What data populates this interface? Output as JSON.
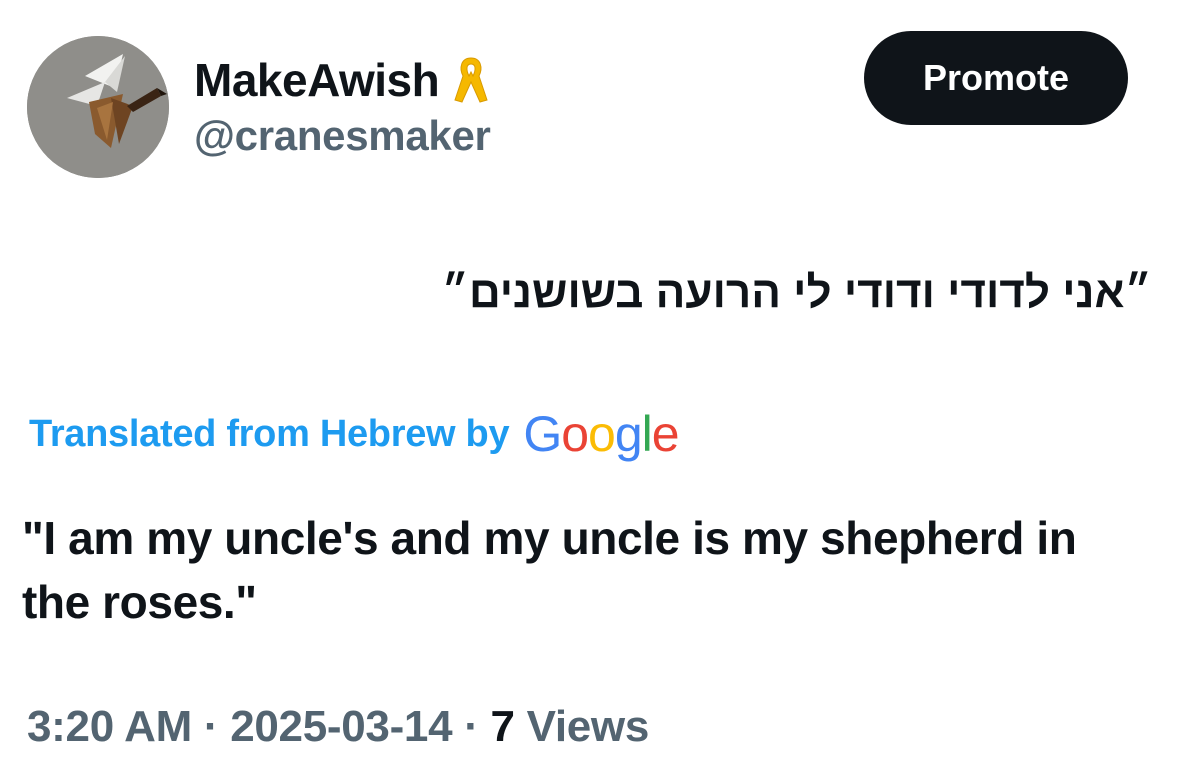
{
  "author": {
    "display_name": "MakeAwish",
    "handle": "@cranesmaker",
    "badge_icon": "yellow-ribbon-icon",
    "avatar_icon": "origami-crane-icon"
  },
  "actions": {
    "promote_label": "Promote"
  },
  "tweet": {
    "original_text": "״אני לדודי ודודי לי הרועה בשושנים״",
    "translated_label": "Translated from Hebrew by",
    "translation_provider": {
      "letters": [
        "G",
        "o",
        "o",
        "g",
        "l",
        "e"
      ],
      "colors": [
        "#4285F4",
        "#EA4335",
        "#FBBC05",
        "#4285F4",
        "#34A853",
        "#EA4335"
      ]
    },
    "translated_text": "\"I am my uncle's and my uncle is my shepherd in the roses.\""
  },
  "meta": {
    "time": "3:20 AM",
    "separator": " · ",
    "date": "2025-03-14",
    "views_count": "7",
    "views_label": " Views"
  },
  "colors": {
    "text_primary": "#0f1419",
    "text_secondary": "#536471",
    "accent": "#1d9bf0",
    "button_bg": "#0f1419",
    "ribbon": "#f5b800"
  }
}
